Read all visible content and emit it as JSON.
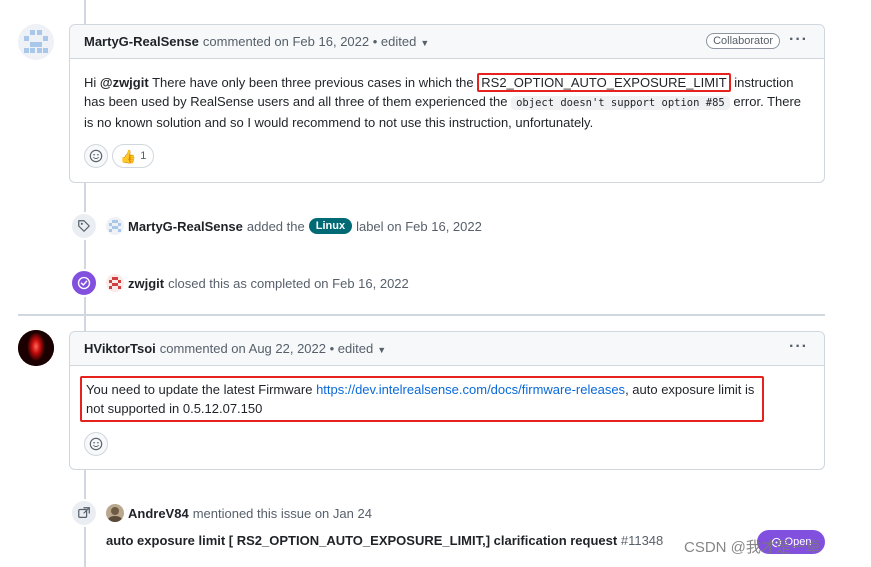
{
  "comment1": {
    "author": "MartyG-RealSense",
    "meta": "commented on Feb 16, 2022 • edited",
    "badge": "Collaborator",
    "text_start": "Hi ",
    "mention": "@zwjgit",
    "text_a": " There have only been three previous cases in which the ",
    "highlight": "RS2_OPTION_AUTO_EXPOSURE_LIMIT",
    "text_b": " instruction has been used by RealSense users and all three of them experienced the ",
    "code": "object doesn't support option #85",
    "text_c": " error. There is no known solution and so I would recommend to not use this instruction, unfortunately.",
    "thumb_count": "1"
  },
  "event_label": {
    "who": "MartyG-RealSense",
    "action": "added the",
    "label": "Linux",
    "suffix": "label on Feb 16, 2022"
  },
  "event_closed": {
    "who": "zwjgit",
    "action": "closed this as completed on Feb 16, 2022"
  },
  "comment2": {
    "author": "HViktorTsoi",
    "meta": "commented on Aug 22, 2022 • edited",
    "text_a": "You need to update the latest Firmware ",
    "link": "https://dev.intelrealsense.com/docs/firmware-releases",
    "text_b": ", auto exposure limit is not supported in 0.5.12.07.150"
  },
  "event_mention": {
    "who": "AndreV84",
    "action": "mentioned this issue on Jan 24"
  },
  "reference": {
    "title": "auto exposure limit [ RS2_OPTION_AUTO_EXPOSURE_LIMIT,] clarification request",
    "number": "#11348",
    "state": "Open"
  },
  "watermark": "CSDN @我才是一卓",
  "colors": {
    "highlight_border": "#e5221e",
    "linux_label": "#006b75",
    "closed_purple": "#8250df",
    "link": "#0969da"
  }
}
